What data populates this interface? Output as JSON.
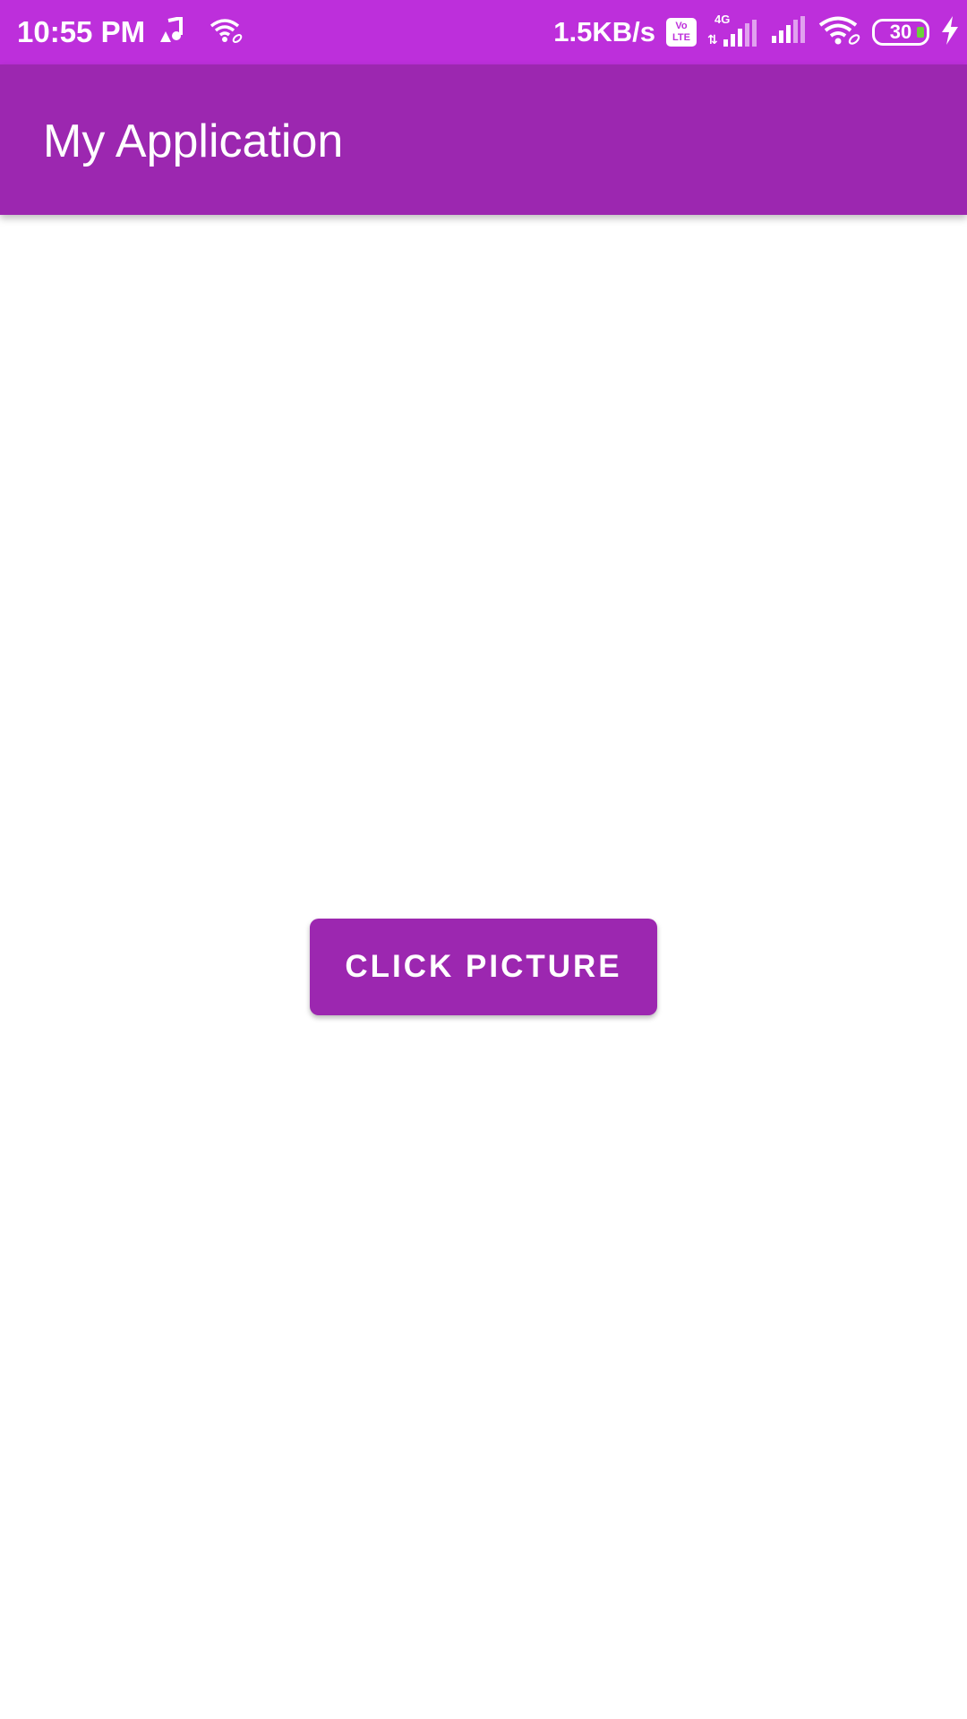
{
  "status_bar": {
    "time": "10:55 PM",
    "net_speed": "1.5KB/s",
    "volte_top": "Vo",
    "volte_bottom": "LTE",
    "network_type": "4G",
    "battery_level": "30",
    "icons": [
      "music-notification-icon",
      "wifi-link-icon",
      "volte-icon",
      "signal-4g-icon",
      "signal-icon",
      "wifi-icon",
      "battery-icon",
      "charging-icon"
    ],
    "background_color": "#bd2fdb"
  },
  "app_bar": {
    "title": "My Application",
    "background_color": "#9c27b0"
  },
  "main": {
    "button_label": "CLICK PICTURE",
    "button_color": "#9c27b0"
  }
}
